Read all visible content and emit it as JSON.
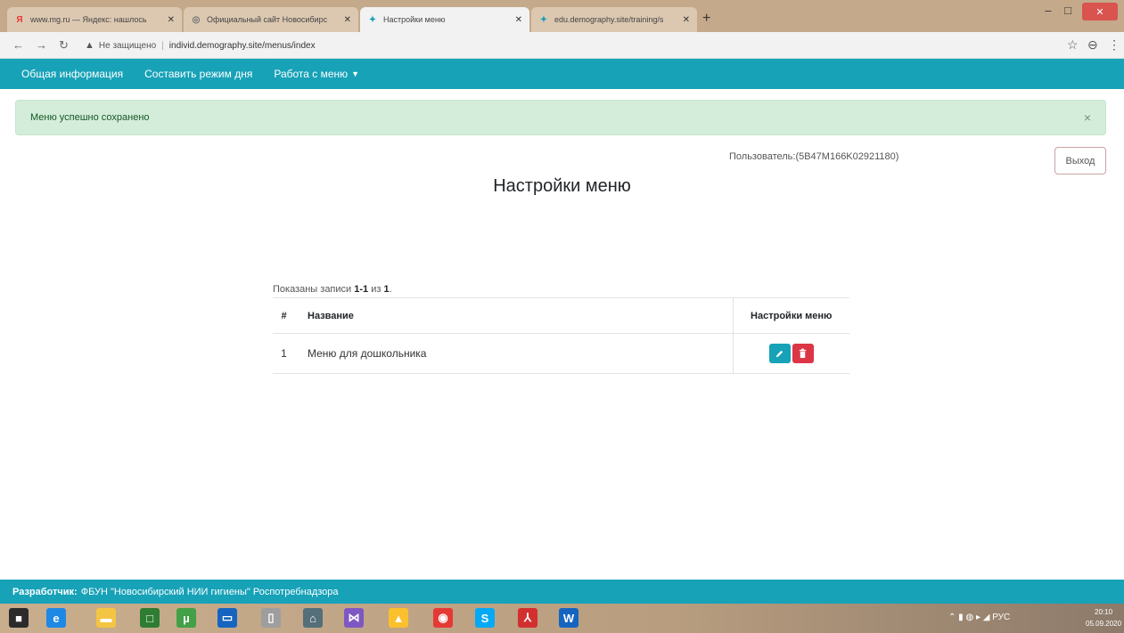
{
  "browser": {
    "tabs": [
      {
        "title": "www.mg.ru — Яндекс: нашлось",
        "favicon": "yandex-icon",
        "color": "#e53935",
        "glyph": "Я"
      },
      {
        "title": "Официальный сайт Новосибирс",
        "favicon": "globe-icon",
        "color": "#6d6d6d",
        "glyph": "◎"
      },
      {
        "title": "Настройки меню",
        "favicon": "site-icon",
        "color": "#17a2b8",
        "glyph": "✦",
        "active": true
      },
      {
        "title": "edu.demography.site/training/s",
        "favicon": "site-icon",
        "color": "#17a2b8",
        "glyph": "✦"
      }
    ],
    "address": {
      "security_label": "Не защищено",
      "url": "individ.demography.site/menus/index"
    }
  },
  "nav": {
    "items": [
      {
        "label": "Общая информация"
      },
      {
        "label": "Составить режим дня"
      },
      {
        "label": "Работа с меню"
      }
    ]
  },
  "alert": {
    "message": "Меню успешно сохранено",
    "close": "×"
  },
  "user": {
    "label": "Пользователь:(5B47M166K02921180)",
    "logout_label": "Выход"
  },
  "page": {
    "title": "Настройки меню"
  },
  "summary": {
    "prefix": "Показаны записи ",
    "range": "1-1",
    "middle": " из ",
    "total": "1",
    "suffix": "."
  },
  "table": {
    "headers": {
      "num": "#",
      "name": "Название",
      "actions": "Настройки меню"
    },
    "rows": [
      {
        "num": "1",
        "name": "Меню для дошкольника"
      }
    ]
  },
  "footer": {
    "label": "Разработчик:",
    "text": "ФБУН \"Новосибирский НИИ гигиены\" Роспотребнадзора"
  },
  "taskbar": {
    "apps": [
      {
        "name": "windows-start-icon",
        "glyph": "■",
        "color": "#2b2b2b"
      },
      {
        "name": "internet-explorer-icon",
        "glyph": "e",
        "color": "#1e88e5"
      },
      {
        "name": "file-explorer-icon",
        "glyph": "▬",
        "color": "#f4c542"
      },
      {
        "name": "store-icon",
        "glyph": "□",
        "color": "#2e7d32"
      },
      {
        "name": "utorrent-icon",
        "glyph": "µ",
        "color": "#43a047"
      },
      {
        "name": "computer-icon",
        "glyph": "▭",
        "color": "#1565c0"
      },
      {
        "name": "document-icon",
        "glyph": "▯",
        "color": "#9e9e9e"
      },
      {
        "name": "home-icon",
        "glyph": "⌂",
        "color": "#546e7a"
      },
      {
        "name": "visual-studio-icon",
        "glyph": "⋈",
        "color": "#7e57c2"
      },
      {
        "name": "app-triangle-icon",
        "glyph": "▲",
        "color": "#fbc02d"
      },
      {
        "name": "chrome-icon",
        "glyph": "◉",
        "color": "#e53935"
      },
      {
        "name": "skype-icon",
        "glyph": "S",
        "color": "#03a9f4"
      },
      {
        "name": "acrobat-icon",
        "glyph": "⅄",
        "color": "#d32f2f"
      },
      {
        "name": "word-icon",
        "glyph": "W",
        "color": "#1565c0"
      }
    ],
    "tray_lang": "РУС",
    "time": "20:10",
    "date": "05.09.2020"
  }
}
